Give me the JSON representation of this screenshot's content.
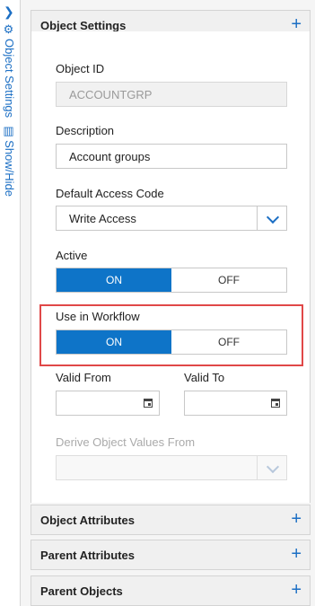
{
  "rail": {
    "title": "Object Settings",
    "show_hide": "Show/Hide"
  },
  "object_settings": {
    "title": "Object Settings",
    "object_id": {
      "label": "Object ID",
      "value": "ACCOUNTGRP"
    },
    "description": {
      "label": "Description",
      "value": "Account groups"
    },
    "default_access_code": {
      "label": "Default Access Code",
      "value": "Write Access"
    },
    "active": {
      "label": "Active",
      "on": "ON",
      "off": "OFF",
      "selected": "ON"
    },
    "use_in_workflow": {
      "label": "Use in Workflow",
      "on": "ON",
      "off": "OFF",
      "selected": "ON"
    },
    "valid_from": {
      "label": "Valid From",
      "value": ""
    },
    "valid_to": {
      "label": "Valid To",
      "value": ""
    },
    "derive_object_values_from": {
      "label": "Derive Object Values From",
      "value": ""
    }
  },
  "sections": {
    "object_attributes": "Object Attributes",
    "parent_attributes": "Parent Attributes",
    "parent_objects": "Parent Objects"
  },
  "colors": {
    "accent": "#0e74c8",
    "highlight": "#e04848"
  }
}
